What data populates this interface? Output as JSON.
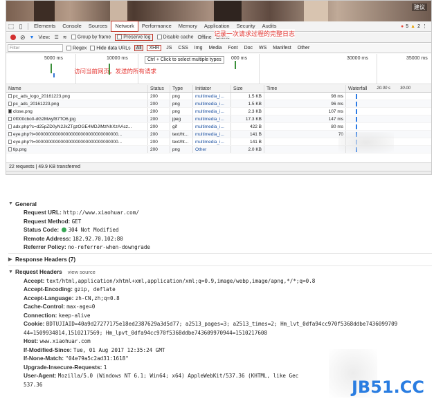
{
  "top_corner_tag": "建议",
  "devtools_tabs": [
    "Elements",
    "Console",
    "Sources",
    "Network",
    "Performance",
    "Memory",
    "Application",
    "Security",
    "Audits"
  ],
  "issues": {
    "errors": "5",
    "warnings": "2"
  },
  "toolbar": {
    "view_label": "View:",
    "group_by_frame": "Group by frame",
    "preserve_log": "Preserve log",
    "disable_cache": "Disable cache",
    "offline": "Offline",
    "online": "Online",
    "annotation": "记录一次请求过程的完整日志"
  },
  "filter": {
    "placeholder": "Filter",
    "regex": "Regex",
    "hide_data_urls": "Hide data URLs",
    "types": [
      "All",
      "XHR",
      "JS",
      "CSS",
      "Img",
      "Media",
      "Font",
      "Doc",
      "WS",
      "Manifest",
      "Other"
    ]
  },
  "overview": {
    "labels": [
      "5000 ms",
      "10000 ms",
      "000 ms",
      "30000 ms",
      "35000 ms"
    ],
    "tooltip": "Ctrl + Click to select multiple types",
    "annotation": "访问当前网页，发送的所有请求"
  },
  "table": {
    "headers": [
      "Name",
      "Status",
      "Type",
      "Initiator",
      "Size",
      "Time",
      "Waterfall",
      "20.00 s",
      "30.00"
    ],
    "rows": [
      {
        "name": "pc_ads_logo_20161223.png",
        "status": "200",
        "type": "png",
        "initiator": "multimedia_i...",
        "size": "1.5 KB",
        "time": "98 ms"
      },
      {
        "name": "pc_ads_20161223.png",
        "status": "200",
        "type": "png",
        "initiator": "multimedia_i...",
        "size": "1.5 KB",
        "time": "96 ms"
      },
      {
        "name": "close.png",
        "status": "200",
        "type": "png",
        "initiator": "multimedia_i...",
        "size": "2.3 KB",
        "time": "107 ms"
      },
      {
        "name": "0f000cbo0-dG2Mwyf87TO6.jpg",
        "status": "200",
        "type": "jpeg",
        "initiator": "multimedia_i...",
        "size": "17.3 KB",
        "time": "147 ms"
      },
      {
        "name": "adx.php?c=d25pZD0yN2JkZTgzOGE4MDJlMzNhXzAAcz...",
        "status": "200",
        "type": "gif",
        "initiator": "multimedia_i...",
        "size": "422 B",
        "time": "80 ms"
      },
      {
        "name": "eye.php?t=000000000000000000000000000000000...",
        "status": "200",
        "type": "text/ht...",
        "initiator": "multimedia_i...",
        "size": "141 B",
        "time": "70"
      },
      {
        "name": "eye.php?t=000000000000000000000000000000000...",
        "status": "200",
        "type": "text/ht...",
        "initiator": "multimedia_i...",
        "size": "141 B",
        "time": ""
      },
      {
        "name": "tip.png",
        "status": "200",
        "type": "png",
        "initiator": "Other",
        "size": "2.0 KB",
        "time": ""
      }
    ]
  },
  "statusbar": "22 requests | 49.9 KB transferred",
  "headers": {
    "general_title": "General",
    "general": [
      {
        "key": "Request URL:",
        "value": "http://www.xiaohuar.com/"
      },
      {
        "key": "Request Method:",
        "value": "GET"
      },
      {
        "key": "Status Code:",
        "value": "304 Not Modified"
      },
      {
        "key": "Remote Address:",
        "value": "182.92.70.102:80"
      },
      {
        "key": "Referrer Policy:",
        "value": "no-referrer-when-downgrade"
      }
    ],
    "response_title": "Response Headers (7)",
    "request_title": "Request Headers",
    "view_source": "view source",
    "request": [
      {
        "key": "Accept:",
        "value": "text/html,application/xhtml+xml,application/xml;q=0.9,image/webp,image/apng,*/*;q=0.8"
      },
      {
        "key": "Accept-Encoding:",
        "value": "gzip, deflate"
      },
      {
        "key": "Accept-Language:",
        "value": "zh-CN,zh;q=0.8"
      },
      {
        "key": "Cache-Control:",
        "value": "max-age=0"
      },
      {
        "key": "Connection:",
        "value": "keep-alive"
      },
      {
        "key": "Cookie:",
        "value": "BDTUJIAID=40a9d27277175e18ed2387629a3d5d77; a2513_pages=3; a2513_times=2; Hm_lvt_0dfa94cc970f5368ddbe7436099709"
      },
      {
        "key": "",
        "value": "44=1509934814,1510217569; Hm_lpvt_0dfa94cc970f5368ddbe743609970944=1510217608"
      },
      {
        "key": "Host:",
        "value": "www.xiaohuar.com"
      },
      {
        "key": "If-Modified-Since:",
        "value": "Tue, 01 Aug 2017 12:35:24 GMT"
      },
      {
        "key": "If-None-Match:",
        "value": "\"04e79a5c2ad31:1618\""
      },
      {
        "key": "Upgrade-Insecure-Requests:",
        "value": "1"
      },
      {
        "key": "User-Agent:",
        "value": "Mozilla/5.0 (Windows NT 6.1; Win64; x64) AppleWebKit/537.36 (KHTML, like Gec"
      },
      {
        "key": "",
        "value": "537.36"
      }
    ]
  },
  "watermark": "JB51.CC",
  "colors": {
    "accent_red": "#e53935",
    "status_green": "#3aa757",
    "watermark_blue": "#2a7de1"
  }
}
